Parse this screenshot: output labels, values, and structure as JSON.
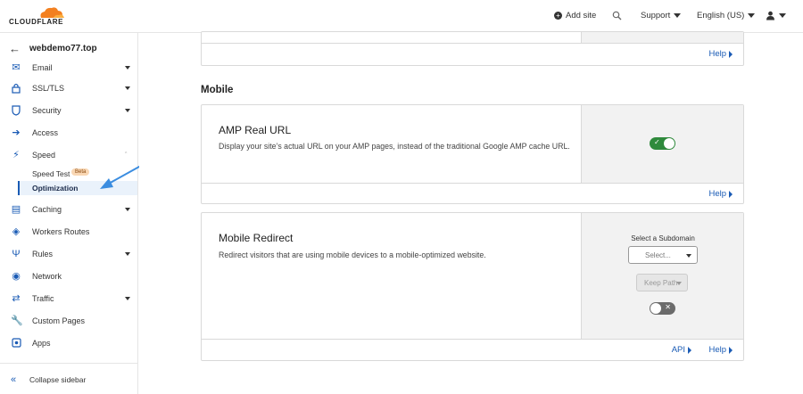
{
  "brand": {
    "logo_text": "CLOUDFLARE",
    "accent": "#f38020"
  },
  "topbar": {
    "add_site": "Add site",
    "support": "Support",
    "language": "English (US)"
  },
  "sidebar": {
    "site_name": "webdemo77.top",
    "items": [
      {
        "label": "Email"
      },
      {
        "label": "SSL/TLS"
      },
      {
        "label": "Security"
      },
      {
        "label": "Access"
      },
      {
        "label": "Speed"
      },
      {
        "label": "Caching"
      },
      {
        "label": "Workers Routes"
      },
      {
        "label": "Rules"
      },
      {
        "label": "Network"
      },
      {
        "label": "Traffic"
      },
      {
        "label": "Custom Pages"
      },
      {
        "label": "Apps"
      }
    ],
    "speed_sub": [
      {
        "label": "Speed Test",
        "badge": "Beta"
      },
      {
        "label": "Optimization"
      }
    ],
    "collapse_label": "Collapse sidebar"
  },
  "main": {
    "top_card": {
      "help": "Help"
    },
    "section_title": "Mobile",
    "amp": {
      "title": "AMP Real URL",
      "description": "Display your site’s actual URL on your AMP pages, instead of the traditional Google AMP cache URL.",
      "enabled": true,
      "help": "Help"
    },
    "mobile_redirect": {
      "title": "Mobile Redirect",
      "description": "Redirect visitors that are using mobile devices to a mobile-optimized website.",
      "subdomain_label": "Select a Subdomain",
      "select_placeholder": "Select...",
      "keep_path": "Keep Path",
      "enabled": false,
      "api": "API",
      "help": "Help"
    }
  },
  "colors": {
    "link": "#1a5bb5",
    "toggle_on": "#2f8a3c",
    "annotation_arrow": "#3b8de0"
  }
}
